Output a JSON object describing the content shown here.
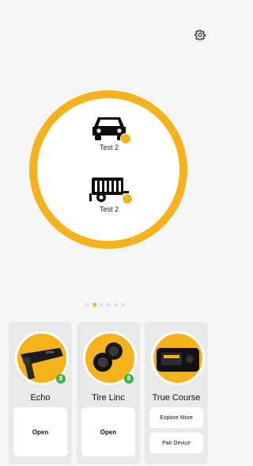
{
  "header": {
    "settings_icon": "gear-icon"
  },
  "colors": {
    "accent": "#f6b21b",
    "badge": "#3fae49"
  },
  "vehicles": [
    {
      "name": "Test 2",
      "icon": "car-icon"
    },
    {
      "name": "Test 2",
      "icon": "trailer-icon"
    }
  ],
  "pager": {
    "count": 6,
    "active_index": 1
  },
  "devices": [
    {
      "name": "Echo",
      "badge": "8",
      "button": "Open"
    },
    {
      "name": "Tire Linc",
      "badge": "8",
      "button": "Open"
    },
    {
      "name": "True Course",
      "buttons": [
        "Explore More",
        "Pair Device"
      ]
    }
  ]
}
